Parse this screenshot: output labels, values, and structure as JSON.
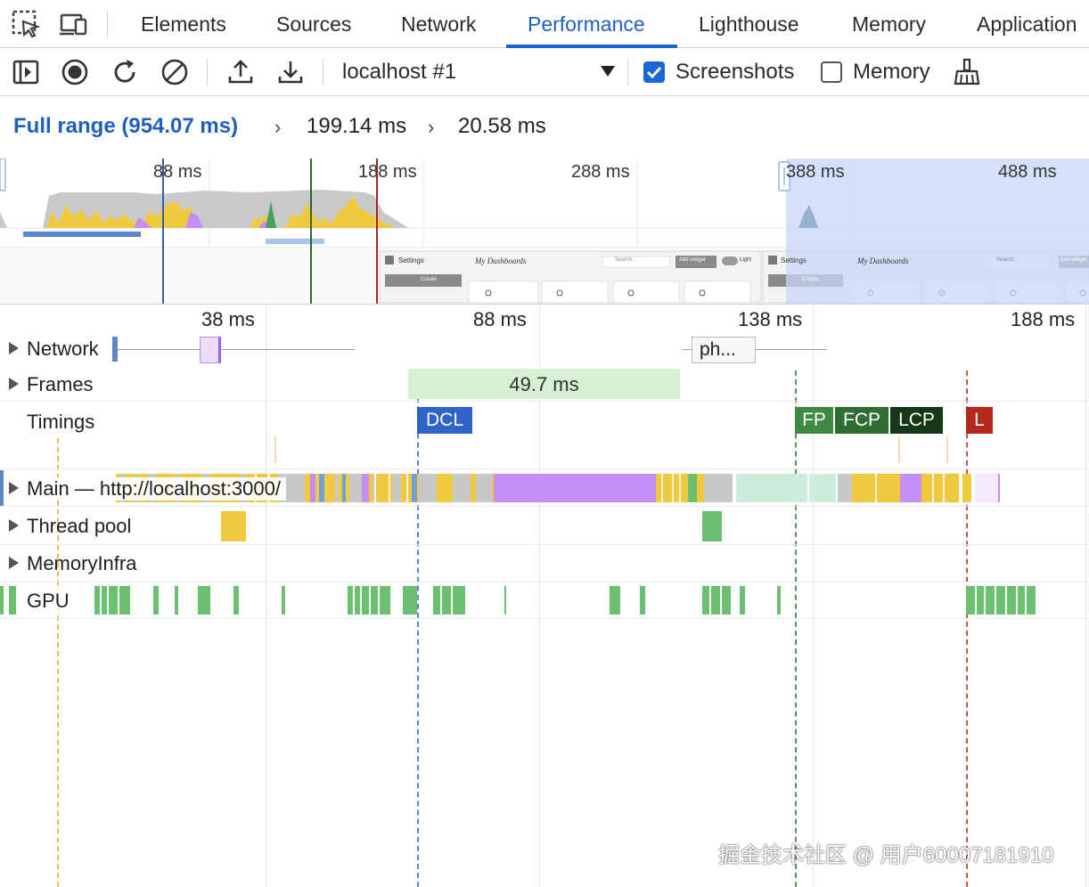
{
  "tabs": [
    {
      "label": "Elements",
      "active": false
    },
    {
      "label": "Sources",
      "active": false
    },
    {
      "label": "Network",
      "active": false
    },
    {
      "label": "Performance",
      "active": true
    },
    {
      "label": "Lighthouse",
      "active": false
    },
    {
      "label": "Memory",
      "active": false
    },
    {
      "label": "Application",
      "active": false
    }
  ],
  "toolbar": {
    "target": "localhost #1",
    "screenshots_label": "Screenshots",
    "screenshots_checked": true,
    "memory_label": "Memory",
    "memory_checked": false
  },
  "breadcrumb": {
    "full_range": "Full range (954.07 ms)",
    "level1": "199.14 ms",
    "level2": "20.58 ms"
  },
  "overview": {
    "ticks": [
      "88 ms",
      "188 ms",
      "288 ms",
      "388 ms",
      "488 ms"
    ],
    "screenshot_thumbs": [
      {
        "title": "Settings",
        "heading": "My Dashboards",
        "search": "Search...",
        "button": "Add widget",
        "toggle": "Light",
        "create": "Create"
      },
      {
        "title": "Settings",
        "heading": "My Dashboards",
        "search": "Search...",
        "button": "Add widget",
        "create": "Create"
      }
    ]
  },
  "ruler": [
    "38 ms",
    "88 ms",
    "138 ms",
    "188 ms"
  ],
  "tracks": {
    "network": "Network",
    "network_request": "ph...",
    "frames": "Frames",
    "frame_duration": "49.7 ms",
    "timings": "Timings",
    "main": "Main — http://localhost:3000/",
    "thread_pool": "Thread pool",
    "memory_infra": "MemoryInfra",
    "gpu": "GPU"
  },
  "timing_markers": [
    {
      "label": "DCL",
      "color": "#2e63c7"
    },
    {
      "label": "FP",
      "color": "#3f8a43"
    },
    {
      "label": "FCP",
      "color": "#2f6e33"
    },
    {
      "label": "LCP",
      "color": "#173818"
    },
    {
      "label": "L",
      "color": "#b5281c"
    }
  ],
  "colors": {
    "accent": "#1a66d9",
    "scripting": "#f0c93f",
    "rendering": "#c48ef7",
    "painting": "#6cbf6f",
    "system": "#c8c8c8"
  },
  "watermark": "掘金技术社区 @ 用户60007181910"
}
